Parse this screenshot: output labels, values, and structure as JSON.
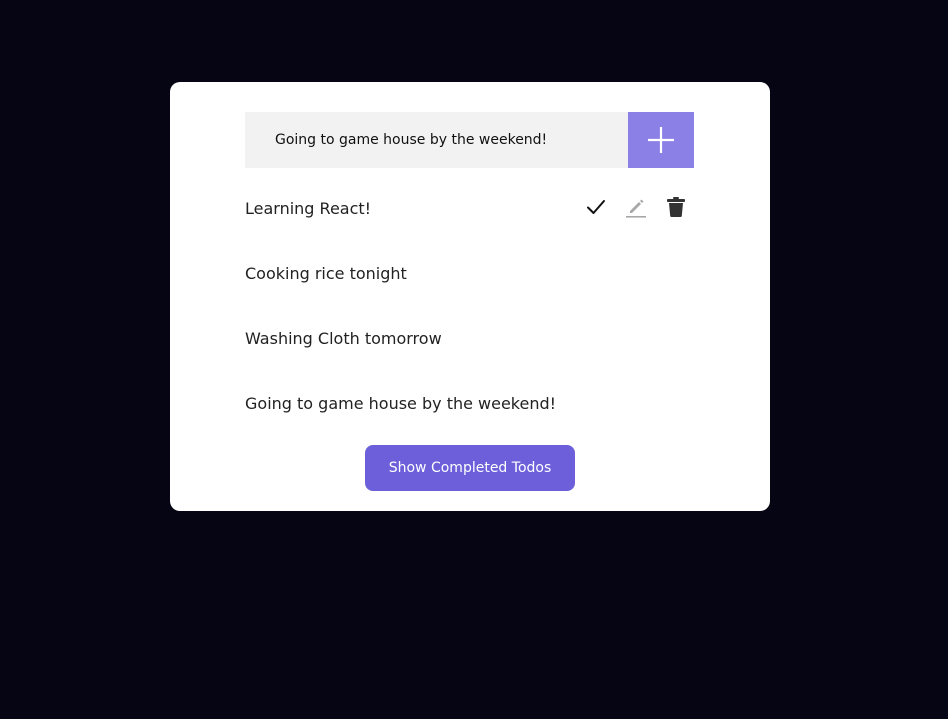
{
  "input": {
    "value": "Going to game house by the weekend!",
    "add_icon": "plus-icon"
  },
  "todos": [
    {
      "text": "Learning React!"
    },
    {
      "text": "Cooking rice tonight"
    },
    {
      "text": "Washing Cloth tomorrow"
    },
    {
      "text": "Going to game house by the weekend!"
    }
  ],
  "item_actions": {
    "complete_icon": "check-icon",
    "edit_icon": "pencil-icon",
    "delete_icon": "trash-icon"
  },
  "show_completed_label": "Show Completed Todos",
  "colors": {
    "background": "#050513",
    "card": "#ffffff",
    "input_bg": "#f2f2f2",
    "add_button": "#8b80e6",
    "primary_button": "#6c5fd9"
  }
}
